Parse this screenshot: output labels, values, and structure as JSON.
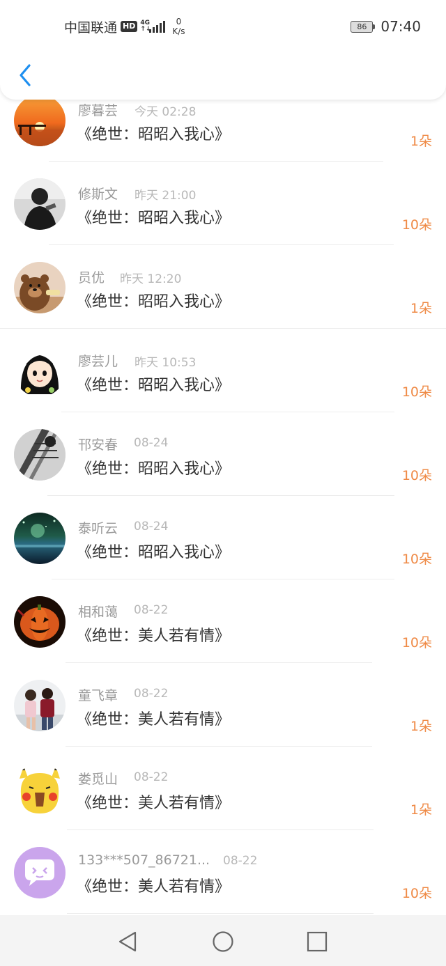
{
  "status_bar": {
    "carrier": "中国联通",
    "hd": "HD",
    "network_top": "4G",
    "network_bottom": "↑↓",
    "speed_value": "0",
    "speed_unit": "K/s",
    "battery": "86",
    "time": "07:40"
  },
  "colors": {
    "accent": "#1e8ff0",
    "count": "#ef8a46",
    "name": "#9a9a9a",
    "time": "#b8b8b8"
  },
  "header": {
    "back_icon": "chevron-left-icon"
  },
  "gifts": [
    {
      "name": "廖暮芸",
      "time": "今天 02:28",
      "book": "《绝世：昭昭入我心》",
      "count": "1朵",
      "avatar": "sunset-photo"
    },
    {
      "name": "修斯文",
      "time": "昨天 21:00",
      "book": "《绝世：昭昭入我心》",
      "count": "10朵",
      "avatar": "person-photo"
    },
    {
      "name": "员优",
      "time": "昨天 12:20",
      "book": "《绝世：昭昭入我心》",
      "count": "1朵",
      "avatar": "bear-cartoon"
    },
    {
      "name": "廖芸儿",
      "time": "昨天 10:53",
      "book": "《绝世：昭昭入我心》",
      "count": "10朵",
      "avatar": "girl-cartoon"
    },
    {
      "name": "邗安春",
      "time": "08-24",
      "book": "《绝世：昭昭入我心》",
      "count": "10朵",
      "avatar": "bw-photo"
    },
    {
      "name": "泰听云",
      "time": "08-24",
      "book": "《绝世：昭昭入我心》",
      "count": "10朵",
      "avatar": "night-scene"
    },
    {
      "name": "相和蔼",
      "time": "08-22",
      "book": "《绝世：美人若有情》",
      "count": "10朵",
      "avatar": "pumpkin"
    },
    {
      "name": "童飞章",
      "time": "08-22",
      "book": "《绝世：美人若有情》",
      "count": "1朵",
      "avatar": "couple-photo"
    },
    {
      "name": "娄觅山",
      "time": "08-22",
      "book": "《绝世：美人若有情》",
      "count": "1朵",
      "avatar": "pikachu"
    },
    {
      "name": "133***507_86721...",
      "time": "08-22",
      "book": "《绝世：美人若有情》",
      "count": "10朵",
      "avatar": "default-chat-avatar"
    }
  ],
  "nav_bar": {
    "back": "triangle-back-icon",
    "home": "circle-home-icon",
    "recents": "square-recents-icon"
  }
}
